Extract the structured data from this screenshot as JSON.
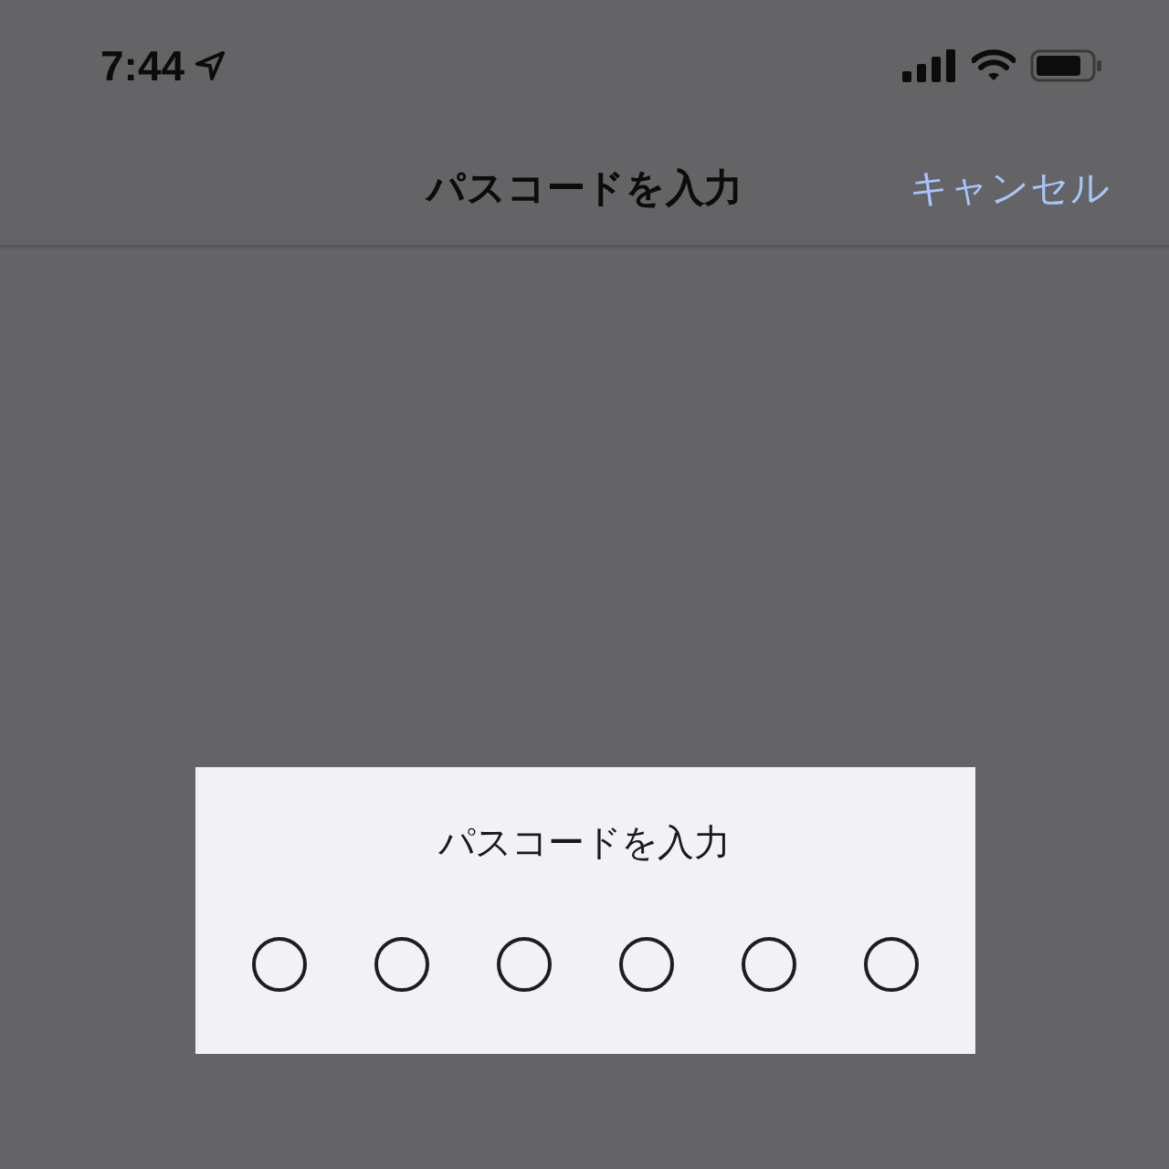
{
  "status_bar": {
    "time": "7:44"
  },
  "nav_bar": {
    "title": "パスコードを入力",
    "cancel": "キャンセル"
  },
  "passcode_dialog": {
    "prompt": "パスコードを入力",
    "digits": [
      {
        "filled": false
      },
      {
        "filled": false
      },
      {
        "filled": false
      },
      {
        "filled": false
      },
      {
        "filled": false
      },
      {
        "filled": false
      }
    ]
  }
}
